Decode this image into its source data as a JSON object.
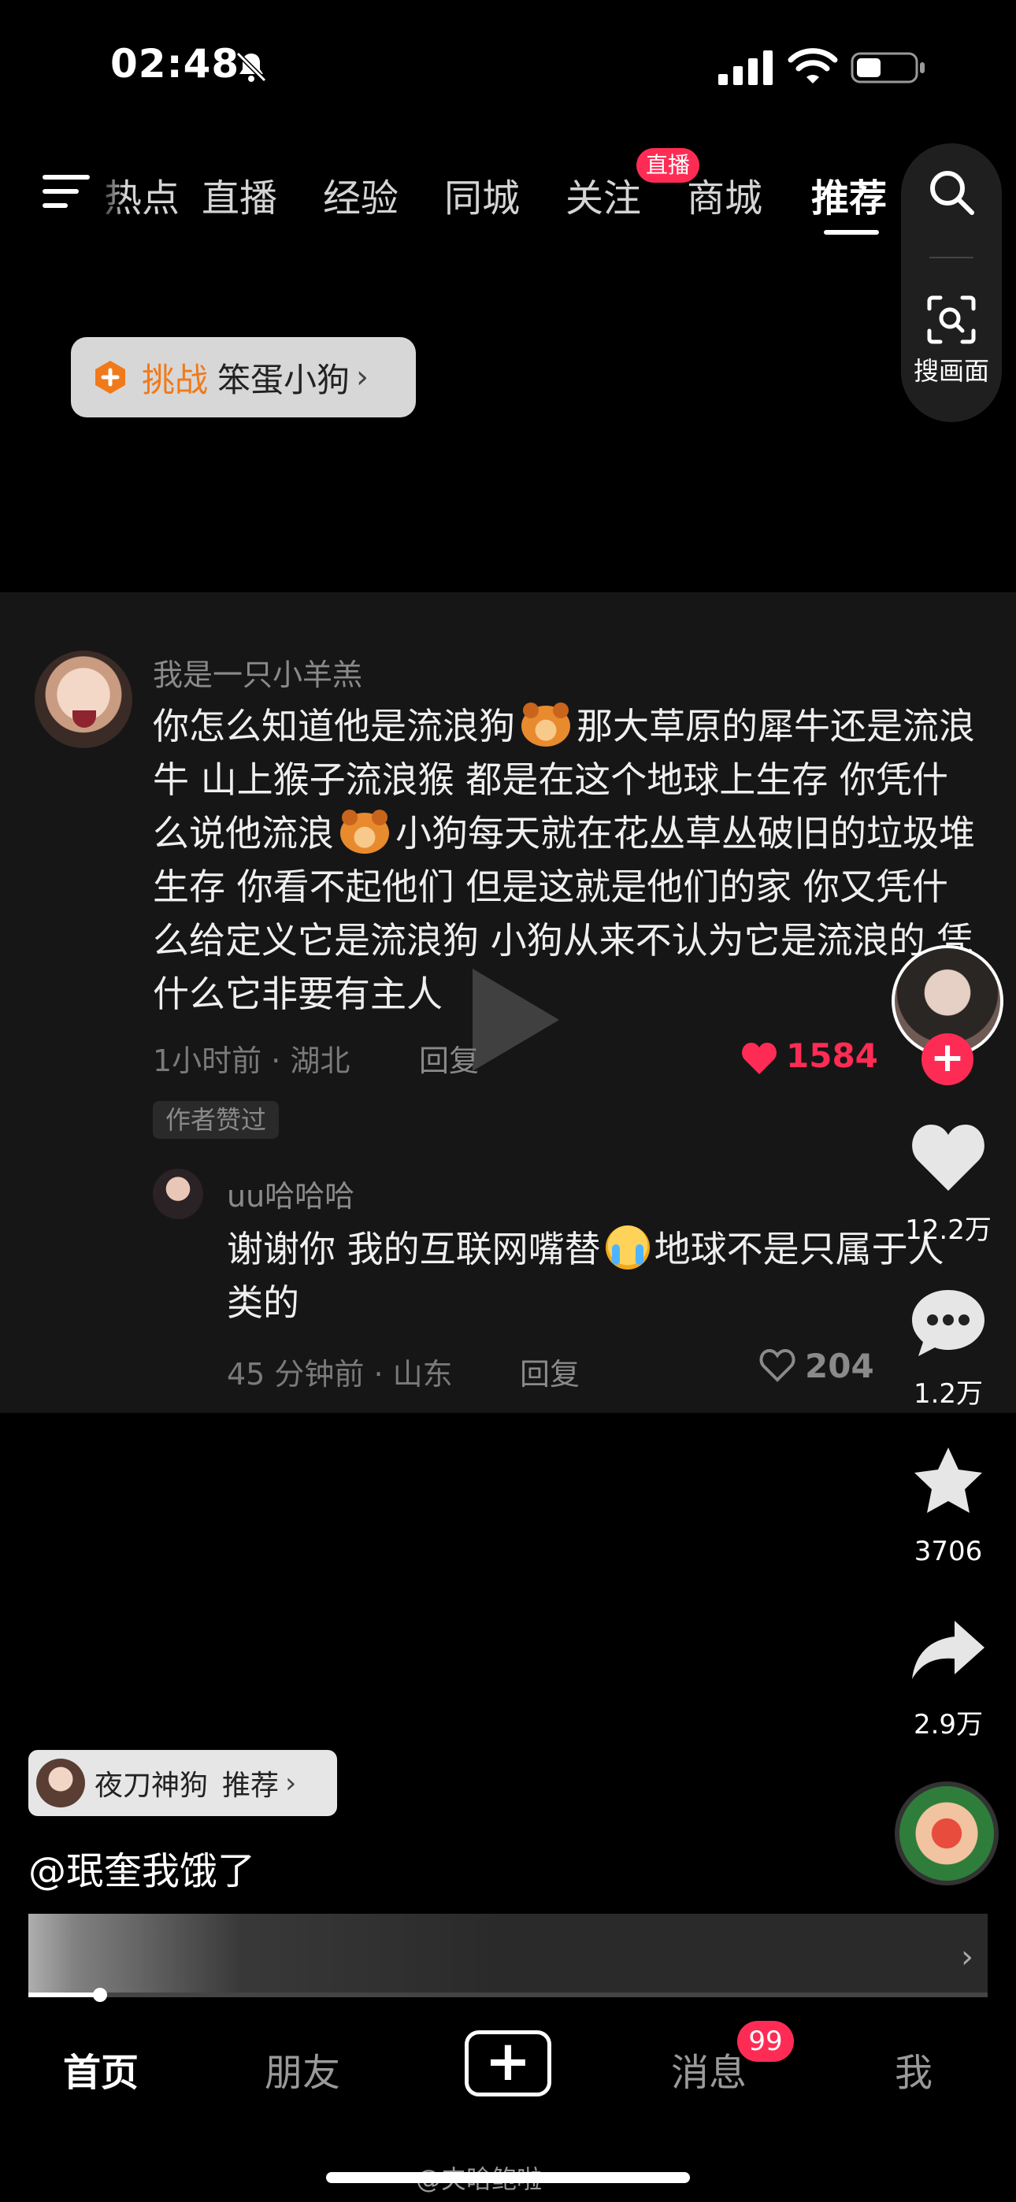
{
  "status_bar": {
    "time": "02:48"
  },
  "top_nav": {
    "tabs": [
      {
        "label": "热点",
        "active": false
      },
      {
        "label": "直播",
        "active": false
      },
      {
        "label": "经验",
        "active": false
      },
      {
        "label": "同城",
        "active": false
      },
      {
        "label": "关注",
        "active": false
      },
      {
        "label": "商城",
        "active": false
      },
      {
        "label": "推荐",
        "active": true
      }
    ],
    "live_badge": "直播",
    "scan_label": "搜画面"
  },
  "challenge": {
    "prefix": "挑战",
    "name": "笨蛋小狗"
  },
  "comment": {
    "username": "我是一只小羊羔",
    "text_1": "你怎么知道他是流浪狗",
    "text_2": "那大草原的犀牛还是流浪牛 山上猴子流浪猴 都是在这个地球上生存 你凭什么说他流浪",
    "text_3": "小狗每天就在花丛草丛破旧的垃圾堆生存 你看不起他们 但是这就是他们的家 你又凭什么给定义它是流浪狗 小狗从来不认为它是流浪的 凭什么它非要有主人",
    "meta": "1小时前 · 湖北",
    "reply_label": "回复",
    "likes": "1584",
    "author_liked": "作者赞过"
  },
  "reply": {
    "username": "uu哈哈哈",
    "text_1": "谢谢你 我的互联网嘴替",
    "text_2": "地球不是只属于人类的",
    "meta": "45 分钟前 · 山东",
    "reply_label": "回复",
    "likes": "204"
  },
  "right_rail": {
    "like_count": "12.2万",
    "comment_count": "1.2万",
    "favorite_count": "3706",
    "share_count": "2.9万"
  },
  "video_info": {
    "recommend_name": "夜刀神狗",
    "recommend_label": "推荐",
    "caption": "@珉奎我饿了"
  },
  "bottom_tabs": {
    "home": "首页",
    "friends": "朋友",
    "messages": "消息",
    "messages_badge": "99",
    "me": "我"
  },
  "watermark": "@夹晗鲍啦",
  "colors": {
    "accent": "#fe2c55",
    "challenge_orange": "#f07a1a"
  }
}
